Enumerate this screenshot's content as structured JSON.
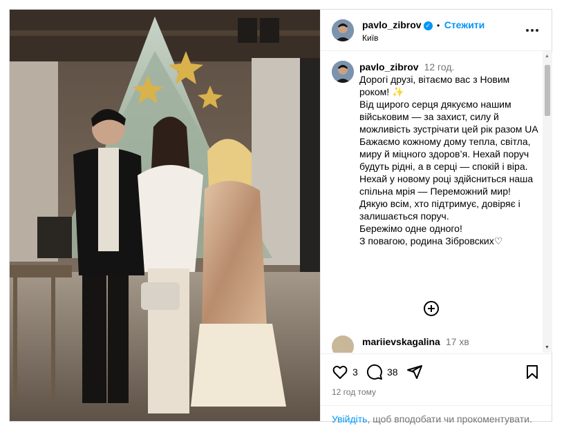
{
  "post": {
    "username": "pavlo_zibrov",
    "follow_label": "Стежити",
    "separator": "•",
    "location": "Київ"
  },
  "caption": {
    "username": "pavlo_zibrov",
    "time": "12 год.",
    "lines": [
      "Дорогі друзі, вітаємо вас з Новим роком! ✨",
      "Від щирого серця дякуємо нашим військовим — за захист, силу й можливість зустрічати цей рік разом UA",
      "Бажаємо кожному дому тепла, світла, миру й міцного здоров’я. Нехай поруч будуть рідні, а в серці — спокій і віра. Нехай у новому році здійсниться наша спільна мрія — Переможний мир! Дякую всім, хто підтримує, довіряє і залишається поруч.",
      "Бережімо одне одного!",
      "З повагою, родина Зібровских♡"
    ]
  },
  "comment": {
    "username": "mariievskagalina",
    "time": "17 хв"
  },
  "actions": {
    "likes": "3",
    "comments": "38",
    "timestamp": "12 год тому"
  },
  "login": {
    "link": "Увійдіть",
    "text": ", щоб вподобати чи прокоментувати."
  },
  "colors": {
    "accent": "#0095f6",
    "muted": "#737373",
    "border": "#dbdbdb"
  },
  "icons": [
    "more-icon",
    "verified-icon",
    "load-more-icon",
    "heart-icon",
    "comment-icon",
    "share-icon",
    "bookmark-icon",
    "scroll-up-icon",
    "scroll-down-icon"
  ]
}
